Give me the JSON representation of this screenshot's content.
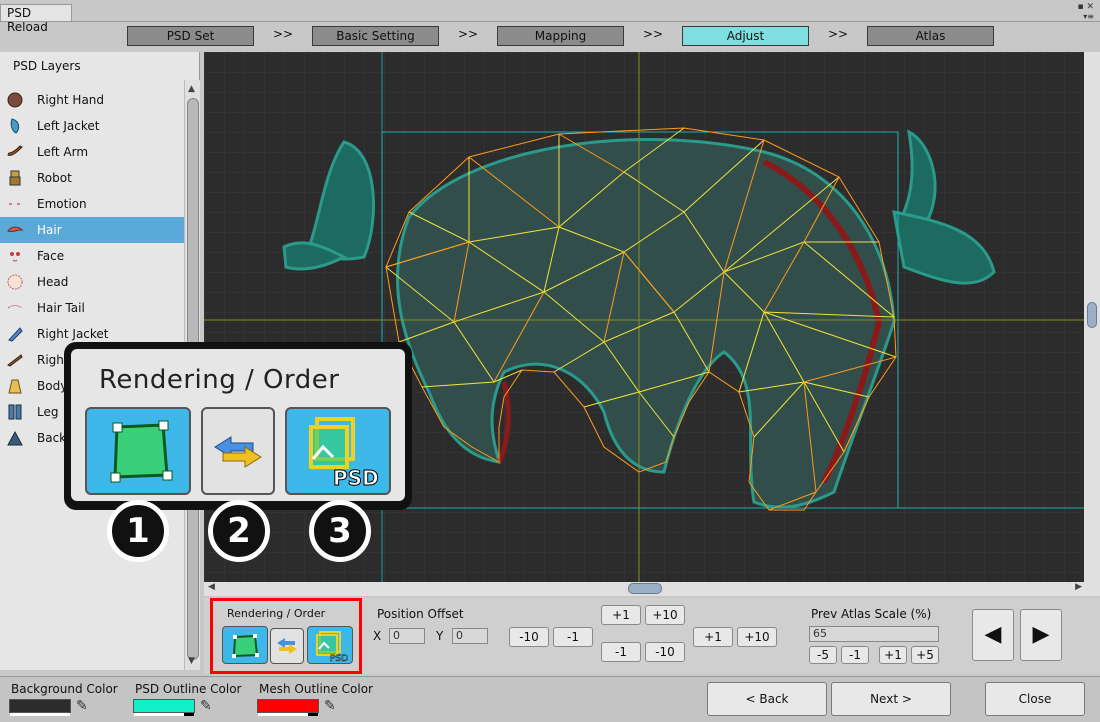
{
  "window": {
    "title": "PSD Reload",
    "menu_glyph": "▪ ✕",
    "menu_dots": "▾≡"
  },
  "steps": [
    {
      "label": "PSD Set",
      "active": false
    },
    {
      "label": "Basic Setting",
      "active": false
    },
    {
      "label": "Mapping",
      "active": false
    },
    {
      "label": "Adjust",
      "active": true
    },
    {
      "label": "Atlas",
      "active": false
    }
  ],
  "step_separator": ">>",
  "layers_panel": {
    "title": "PSD Layers",
    "items": [
      {
        "label": "Right Hand",
        "icon": "right-hand-icon"
      },
      {
        "label": "Left Jacket",
        "icon": "left-jacket-icon"
      },
      {
        "label": "Left Arm",
        "icon": "left-arm-icon"
      },
      {
        "label": "Robot",
        "icon": "robot-icon"
      },
      {
        "label": "Emotion",
        "icon": "emotion-icon"
      },
      {
        "label": "Hair",
        "icon": "hair-icon",
        "selected": true
      },
      {
        "label": "Face",
        "icon": "face-icon"
      },
      {
        "label": "Head",
        "icon": "head-icon"
      },
      {
        "label": "Hair Tail",
        "icon": "hair-tail-icon"
      },
      {
        "label": "Right Jacket",
        "icon": "right-jacket-icon"
      },
      {
        "label": "Right",
        "icon": "right-arm-icon"
      },
      {
        "label": "Body",
        "icon": "body-icon"
      },
      {
        "label": "Leg",
        "icon": "leg-icon"
      },
      {
        "label": "Back",
        "icon": "back-icon"
      }
    ]
  },
  "controls": {
    "rendering_order_label": "Rendering / Order",
    "position_offset_label": "Position Offset",
    "x_label": "X",
    "y_label": "Y",
    "x_value": "0",
    "y_value": "0",
    "x_minus10": "-10",
    "x_minus1": "-1",
    "y_plus1": "+1",
    "y_plus10": "+10",
    "y_minus1": "-1",
    "y_minus10": "-10",
    "x_plus1": "+1",
    "x_plus10": "+10",
    "prev_atlas_scale_label": "Prev Atlas Scale (%)",
    "prev_atlas_scale_value": "65",
    "scale_minus5": "-5",
    "scale_minus1": "-1",
    "scale_plus1": "+1",
    "scale_plus5": "+5",
    "prev_arrow": "◀",
    "next_arrow": "▶"
  },
  "bottom": {
    "background_color_label": "Background Color",
    "psd_outline_color_label": "PSD Outline Color",
    "mesh_outline_color_label": "Mesh Outline Color",
    "background_color": "#2c2c2c",
    "psd_outline_color": "#10f0c8",
    "mesh_outline_color": "#ff0000",
    "back_button": "< Back",
    "next_button": "Next >",
    "close_button": "Close"
  },
  "callout": {
    "title": "Rendering / Order",
    "markers": [
      "1",
      "2",
      "3"
    ],
    "psd_badge": "PSD"
  },
  "icons": {
    "eyedropper": "eyedropper-icon",
    "mesh_toggle": "mesh-square-icon",
    "swap": "swap-arrows-icon",
    "psd_overlay": "psd-overlay-icon"
  },
  "colors": {
    "active_step": "#7fdfe0",
    "selected_layer": "#5aa9d8",
    "highlight": "#ff0000",
    "mesh_orange": "#ff9a1a",
    "mesh_yellow": "#f2e23a",
    "psd_teal": "#2a9a8a"
  }
}
